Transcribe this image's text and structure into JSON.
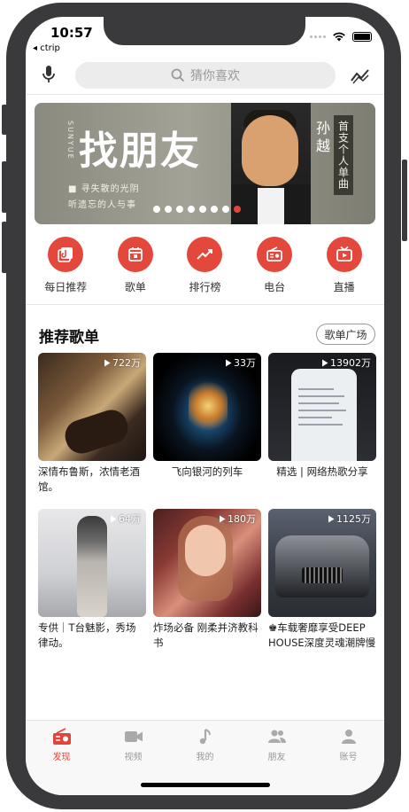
{
  "status_bar": {
    "time": "10:57",
    "back_app": "◂ ctrip"
  },
  "header": {
    "search_placeholder": "猜你喜欢"
  },
  "banner": {
    "title": "找朋友",
    "vertical_text": "SUNYUE",
    "line1": "■ 寻失散的光阴",
    "line2": "听遗忘的人与事",
    "artist": "孙越",
    "tag": "首支个人单曲",
    "dot_count": 8,
    "active_dot": 7
  },
  "categories": [
    {
      "label": "每日推荐",
      "icon": "daily-icon"
    },
    {
      "label": "歌单",
      "icon": "playlist-icon"
    },
    {
      "label": "排行榜",
      "icon": "chart-icon"
    },
    {
      "label": "电台",
      "icon": "radio-icon"
    },
    {
      "label": "直播",
      "icon": "live-icon"
    }
  ],
  "section": {
    "title": "推荐歌单",
    "more_label": "歌单广场"
  },
  "playlists": [
    {
      "plays": "722万",
      "title": "深情布鲁斯，浓情老酒馆。"
    },
    {
      "plays": "33万",
      "title": "飞向银河的列车"
    },
    {
      "plays": "13902万",
      "title": "精选 | 网络热歌分享"
    },
    {
      "plays": "64万",
      "title": "专供｜T台魅影，秀场律动。"
    },
    {
      "plays": "180万",
      "title": "炸场必备 刚柔并济教科书"
    },
    {
      "plays": "1125万",
      "title": "♚车载奢靡享受DEEP HOUSE深度灵魂潮牌慢"
    }
  ],
  "tabbar": [
    {
      "label": "发现",
      "icon": "radio-icon",
      "active": true
    },
    {
      "label": "视频",
      "icon": "video-icon",
      "active": false
    },
    {
      "label": "我的",
      "icon": "music-note-icon",
      "active": false
    },
    {
      "label": "朋友",
      "icon": "friends-icon",
      "active": false
    },
    {
      "label": "账号",
      "icon": "account-icon",
      "active": false
    }
  ],
  "colors": {
    "accent": "#e4483c",
    "active_tab": "#e0463b"
  }
}
